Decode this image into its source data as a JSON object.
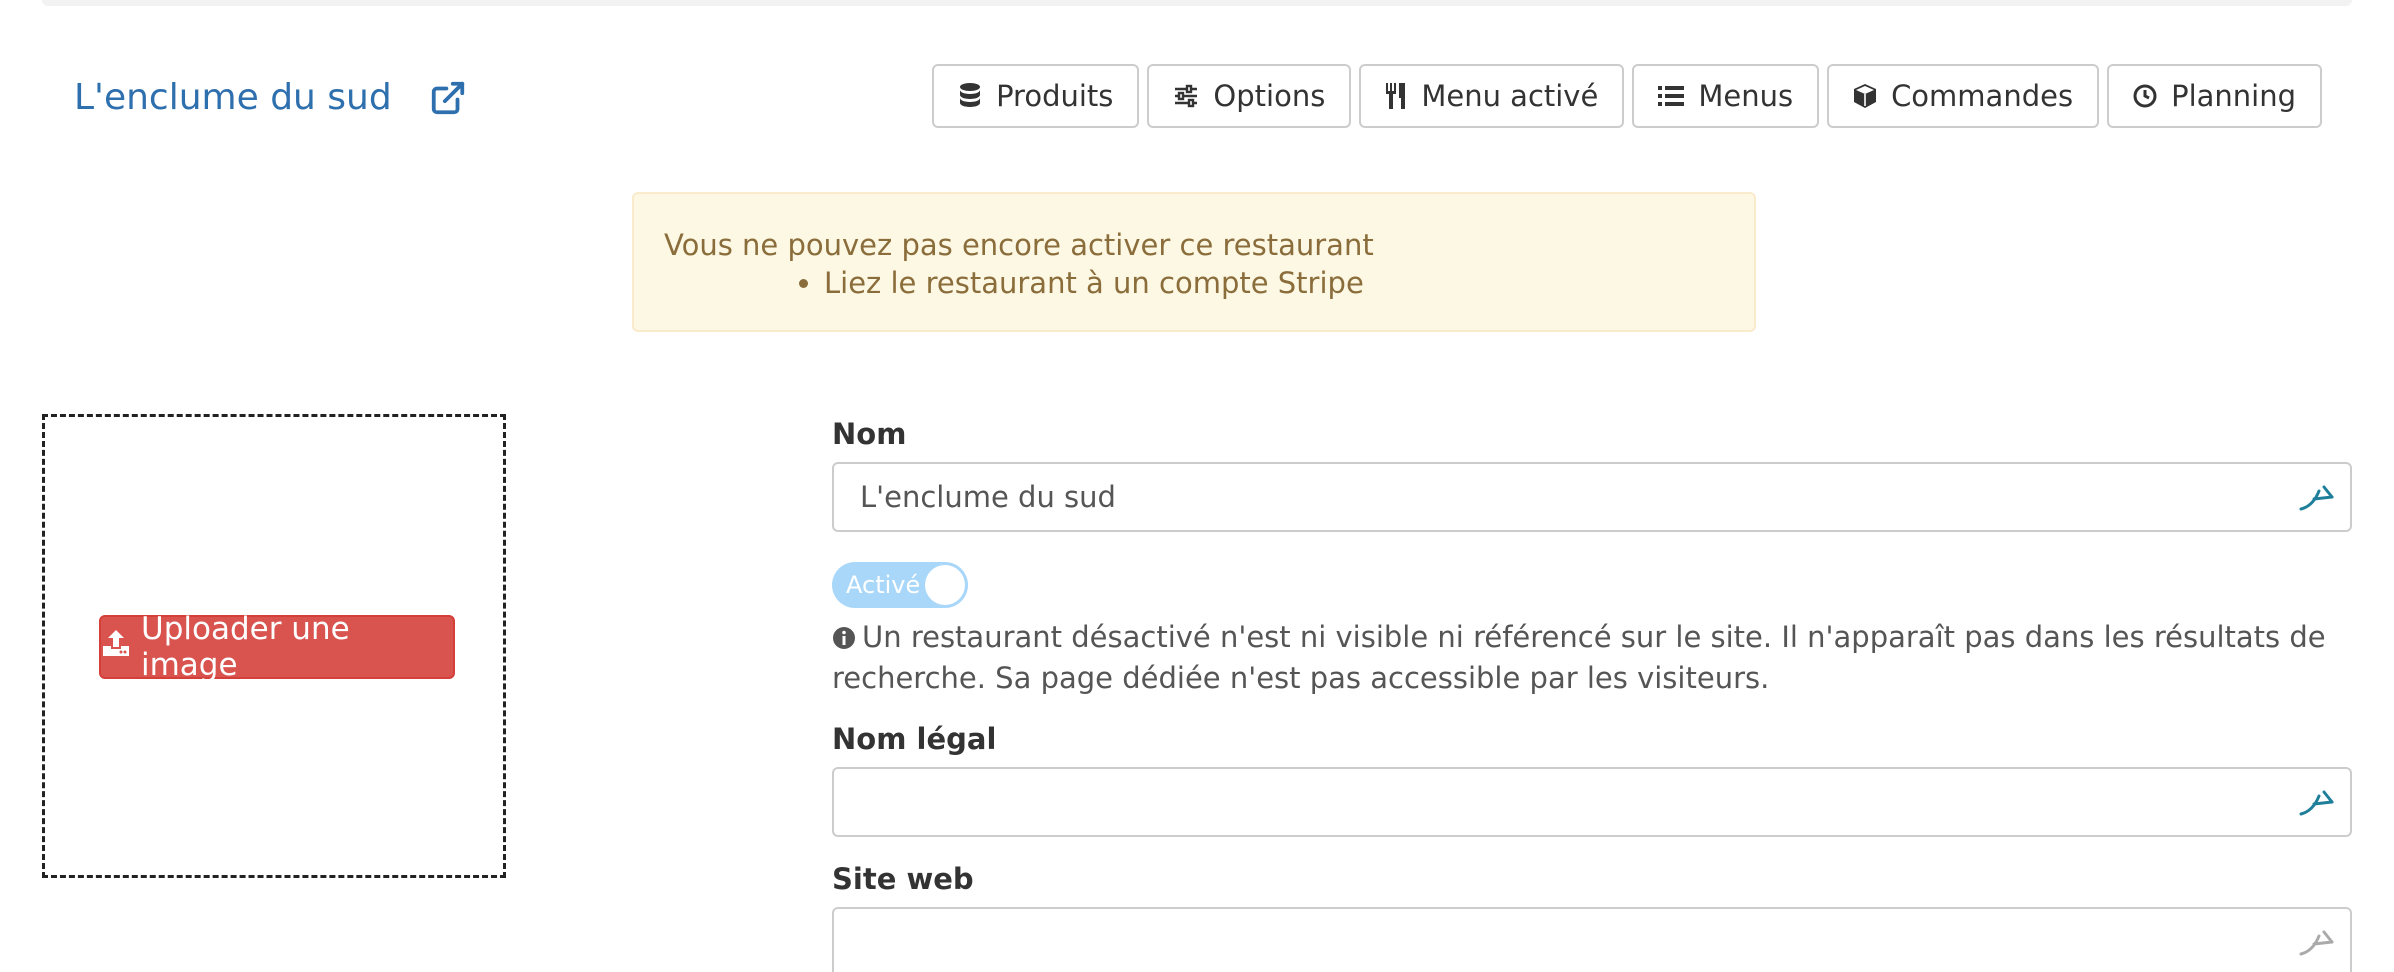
{
  "header": {
    "title": "L'enclume du sud",
    "external_link_icon": "external-link-icon"
  },
  "nav": [
    {
      "label": "Produits",
      "icon": "database-icon"
    },
    {
      "label": "Options",
      "icon": "sliders-icon"
    },
    {
      "label": "Menu activé",
      "icon": "cutlery-icon"
    },
    {
      "label": "Menus",
      "icon": "list-icon"
    },
    {
      "label": "Commandes",
      "icon": "cube-icon"
    },
    {
      "label": "Planning",
      "icon": "clock-icon"
    }
  ],
  "alert": {
    "message": "Vous ne pouvez pas encore activer ce restaurant",
    "items": [
      "Liez le restaurant à un compte Stripe"
    ]
  },
  "upload": {
    "button_label": "Uploader une image",
    "icon": "upload-icon"
  },
  "form": {
    "name_label": "Nom",
    "name_value": "L'enclume du sud",
    "toggle_label": "Activé",
    "help_text": "Un restaurant désactivé n'est ni visible ni référencé sur le site. Il n'apparaît pas dans les résultats de recherche. Sa page dédiée n'est pas accessible par les visiteurs.",
    "legal_name_label": "Nom légal",
    "legal_name_value": "",
    "website_label": "Site web",
    "website_value": ""
  },
  "colors": {
    "link": "#2e6fae",
    "alert_bg": "#fcf8e3",
    "alert_text": "#8a6d3b",
    "danger": "#d9534f",
    "toggle": "#a8d7fa"
  }
}
